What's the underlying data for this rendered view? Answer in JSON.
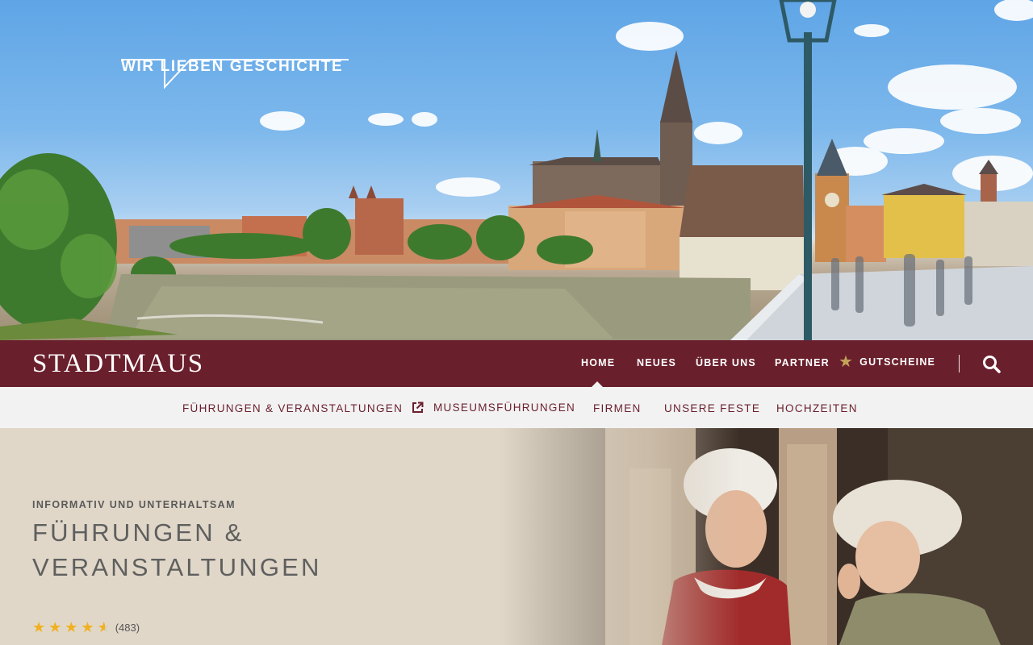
{
  "hero": {
    "tagline": "WIR LIEBEN GESCHICHTE",
    "image_label": "Regensburg Altstadt mit Dom und Steinerner Brücke"
  },
  "nav": {
    "logo": "STADTMAUS",
    "items": [
      {
        "label": "HOME",
        "active": true
      },
      {
        "label": "NEUES"
      },
      {
        "label": "ÜBER UNS"
      },
      {
        "label": "PARTNER"
      },
      {
        "label": "GUTSCHEINE",
        "icon": "star-icon"
      }
    ],
    "search_icon": "search-icon"
  },
  "subnav": {
    "items": [
      {
        "label": "FÜHRUNGEN & VERANSTALTUNGEN"
      },
      {
        "label": "MUSEUMSFÜHRUNGEN",
        "icon": "external-link-icon"
      },
      {
        "label": "FIRMEN"
      },
      {
        "label": "UNSERE FESTE"
      },
      {
        "label": "HOCHZEITEN"
      }
    ]
  },
  "content": {
    "kicker": "INFORMATIV UND UNTERHALTSAM",
    "headline_line1": "FÜHRUNGEN &",
    "headline_line2": "VERANSTALTUNGEN",
    "rating": {
      "stars": 4.5,
      "count": "(483)"
    }
  },
  "colors": {
    "brand": "#6a1f2c",
    "subnav_bg": "#f2f2f2",
    "content_bg": "#e0d7c8",
    "star": "#f2b01e",
    "gold": "#c3a35a"
  }
}
